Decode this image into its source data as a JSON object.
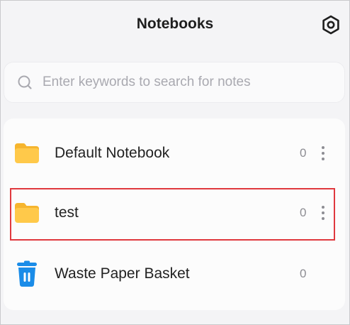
{
  "header": {
    "title": "Notebooks",
    "settings_icon": "hexagon-settings-icon"
  },
  "search": {
    "placeholder": "Enter keywords to search for notes",
    "value": "",
    "icon": "search-icon"
  },
  "notebooks": [
    {
      "label": "Default Notebook",
      "count": "0",
      "icon": "folder-icon",
      "has_menu": true
    },
    {
      "label": "test",
      "count": "0",
      "icon": "folder-icon",
      "has_menu": true,
      "highlighted": true
    },
    {
      "label": "Waste Paper Basket",
      "count": "0",
      "icon": "trash-icon",
      "has_menu": false
    }
  ],
  "colors": {
    "folder": "#ffc94a",
    "folder_tab": "#f6b52e",
    "trash": "#1a8ce8",
    "highlight_border": "#e0393e"
  }
}
